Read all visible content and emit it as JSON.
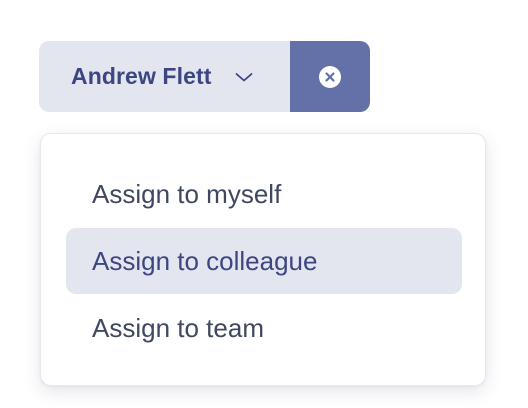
{
  "assignee": {
    "selected_name": "Andrew Flett"
  },
  "icons": {
    "dropdown_chevron": "chevron-down-icon",
    "clear": "close-circle-icon"
  },
  "menu": {
    "items": [
      {
        "label": "Assign to myself",
        "active": false
      },
      {
        "label": "Assign to colleague",
        "active": true
      },
      {
        "label": "Assign to team",
        "active": false
      }
    ]
  },
  "colors": {
    "accent": "#6470a8",
    "selected_text": "#3b4682",
    "highlight_bg": "#e4e6ef",
    "menu_text": "#3f4860"
  }
}
